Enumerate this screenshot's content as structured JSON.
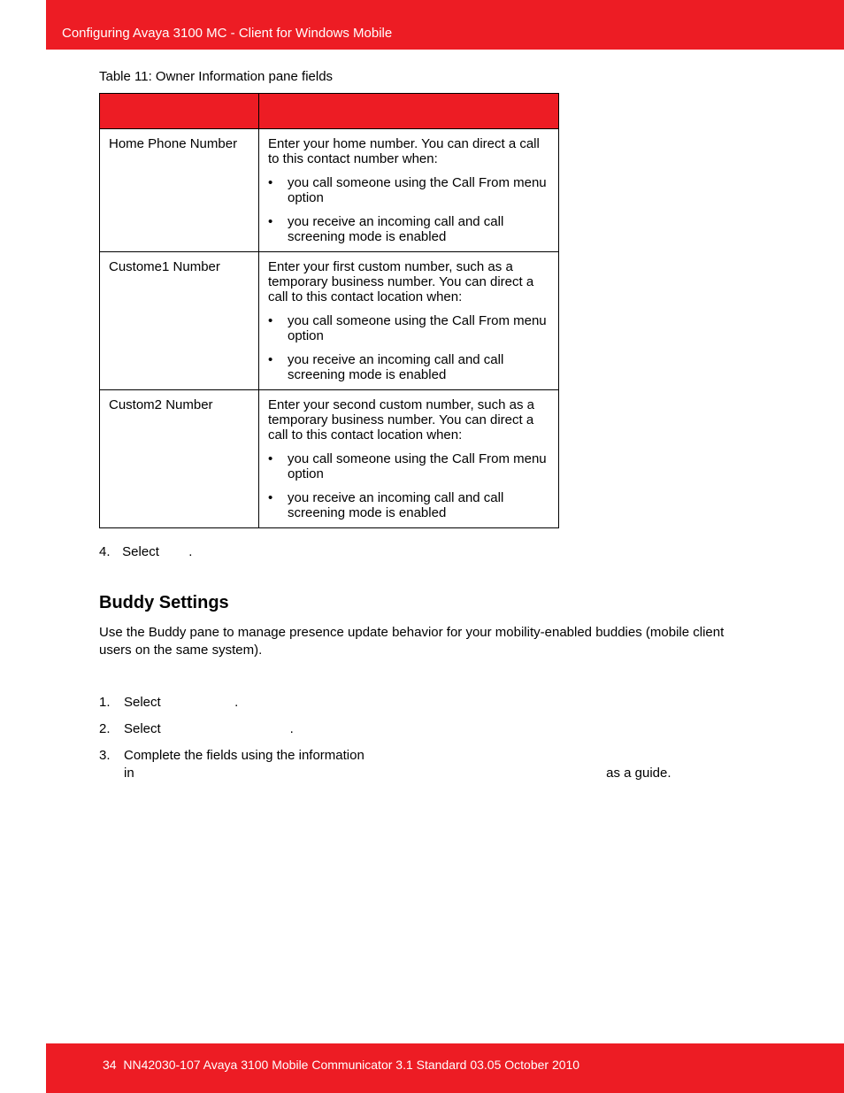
{
  "header": {
    "title": "Configuring Avaya 3100 MC - Client for Windows Mobile"
  },
  "table": {
    "caption": "Table 11: Owner Information pane fields",
    "rows": [
      {
        "field": "Home Phone Number",
        "intro": "Enter your home number. You can direct a call to this contact number when:",
        "bullets": [
          "you call someone using the Call From menu option",
          "you receive an incoming call and call screening mode is enabled"
        ]
      },
      {
        "field": "Custome1 Number",
        "intro": "Enter your first custom number, such as a temporary business number. You can direct a call to this contact location when:",
        "bullets": [
          "you call someone using the Call From menu option",
          "you receive an incoming call and call screening mode is enabled"
        ]
      },
      {
        "field": "Custom2 Number",
        "intro": "Enter your second custom number, such as a temporary business number. You can direct a call to this contact location when:",
        "bullets": [
          "you call someone using the Call From menu option",
          "you receive an incoming call and call screening mode is enabled"
        ]
      }
    ]
  },
  "step4": {
    "number": "4.",
    "text": "Select",
    "suffix": "."
  },
  "section": {
    "heading": "Buddy Settings",
    "intro": "Use the Buddy pane to manage presence update behavior for your mobility-enabled buddies (mobile client users on the same system).",
    "steps": [
      {
        "n": "1.",
        "text": "Select",
        "suffix": "."
      },
      {
        "n": "2.",
        "text": "Select",
        "suffix": "."
      },
      {
        "n": "3.",
        "text": "Complete the fields using the information in",
        "trail": "as a guide."
      }
    ]
  },
  "footer": {
    "page": "34",
    "text": "NN42030-107 Avaya 3100 Mobile Communicator 3.1 Standard 03.05 October 2010"
  }
}
